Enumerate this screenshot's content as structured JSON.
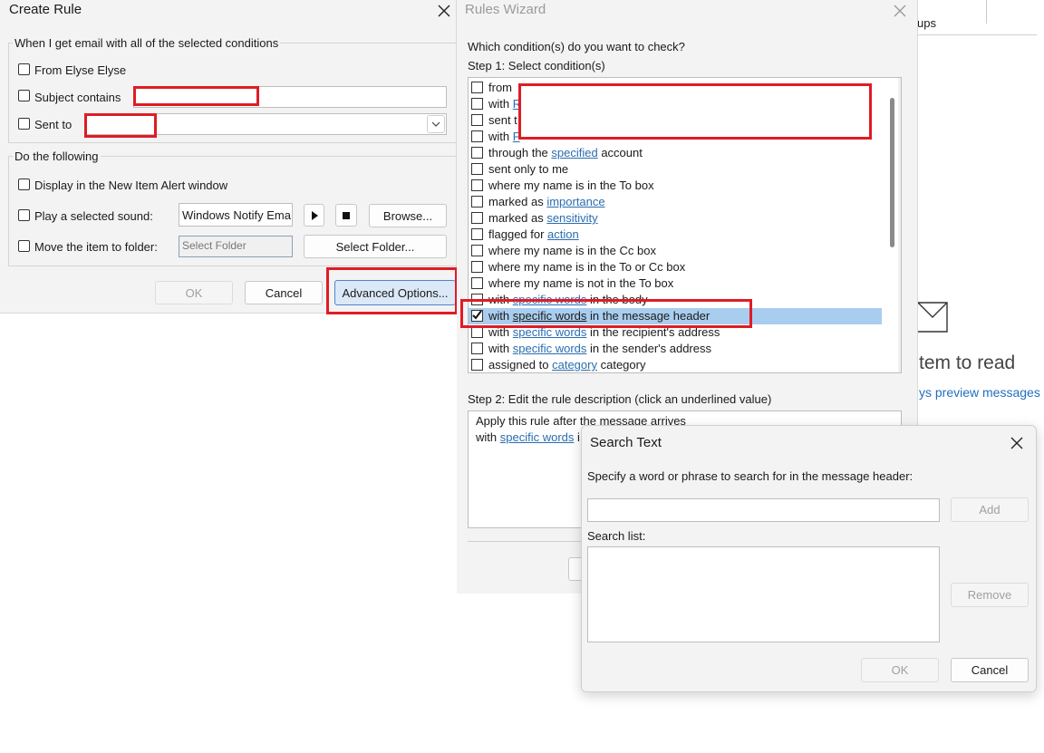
{
  "create_rule": {
    "title": "Create Rule",
    "group1_title": "When I get email with all of the selected conditions",
    "from_label": "From Elyse Elyse",
    "subject_label": "Subject contains",
    "sent_to_label": "Sent to",
    "group2_title": "Do the following",
    "display_alert_label": "Display in the New Item Alert window",
    "play_sound_label": "Play a selected sound:",
    "sound_value": "Windows Notify Ema",
    "browse_label": "Browse...",
    "move_folder_label": "Move the item to folder:",
    "folder_placeholder": "Select Folder",
    "select_folder_label": "Select Folder...",
    "ok_label": "OK",
    "cancel_label": "Cancel",
    "advanced_label": "Advanced Options..."
  },
  "rules_wizard": {
    "title": "Rules Wizard",
    "question": "Which condition(s) do you want to check?",
    "step1": "Step 1: Select condition(s)",
    "conditions": [
      {
        "pre": "from",
        "link": "",
        "post": ""
      },
      {
        "pre": "with ",
        "link": "R",
        "post": ""
      },
      {
        "pre": "sent t",
        "link": "",
        "post": ""
      },
      {
        "pre": "with ",
        "link": "F",
        "post": ""
      },
      {
        "pre": "through the ",
        "link": "specified",
        "post": " account"
      },
      {
        "pre": "sent only to me",
        "link": "",
        "post": ""
      },
      {
        "pre": "where my name is in the To box",
        "link": "",
        "post": ""
      },
      {
        "pre": "marked as ",
        "link": "importance",
        "post": ""
      },
      {
        "pre": "marked as ",
        "link": "sensitivity",
        "post": ""
      },
      {
        "pre": "flagged for ",
        "link": "action",
        "post": ""
      },
      {
        "pre": "where my name is in the Cc box",
        "link": "",
        "post": ""
      },
      {
        "pre": "where my name is in the To or Cc box",
        "link": "",
        "post": ""
      },
      {
        "pre": "where my name is not in the To box",
        "link": "",
        "post": ""
      },
      {
        "pre": "with ",
        "link": "specific words",
        "post": " in the body"
      },
      {
        "pre": "with ",
        "link": "specific words",
        "post": " in the message header"
      },
      {
        "pre": "with ",
        "link": "specific words",
        "post": " in the recipient's address"
      },
      {
        "pre": "with ",
        "link": "specific words",
        "post": " in the sender's address"
      },
      {
        "pre": "assigned to ",
        "link": "category",
        "post": " category"
      }
    ],
    "step2": "Step 2: Edit the rule description (click an underlined value)",
    "desc_line1": "Apply this rule after the message arrives",
    "desc_line2_pre": "with ",
    "desc_line2_link": "specific words",
    "desc_line2_post": " i"
  },
  "search_text": {
    "title": "Search Text",
    "prompt": "Specify a word or phrase to search for in the message header:",
    "input_value": "",
    "add_label": "Add",
    "search_list_label": "Search list:",
    "remove_label": "Remove",
    "ok_label": "OK",
    "cancel_label": "Cancel"
  },
  "background": {
    "ups_text": "ups",
    "item_to_read": "tem to read",
    "preview_link": "ys preview messages"
  }
}
